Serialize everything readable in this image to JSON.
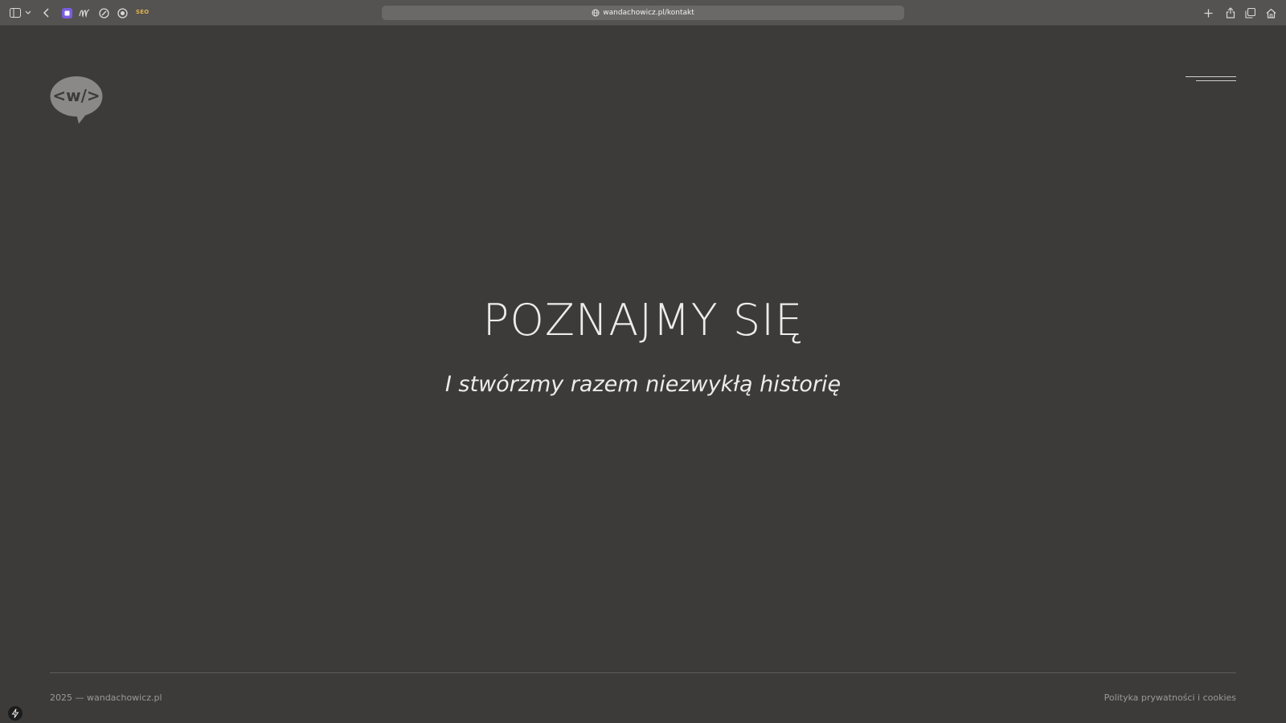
{
  "browser": {
    "url": "wandachowicz.pl/kontakt",
    "extensions_seo_label": "SEO",
    "icons": [
      "sidebar-icon",
      "chevron-down-icon",
      "back-icon",
      "extension-purple-icon",
      "m-script-icon",
      "compass-icon",
      "target-icon",
      "plus-icon",
      "share-icon",
      "tabs-icon",
      "home-icon"
    ]
  },
  "header": {
    "logo_text": "<w/>",
    "menu_icon": "hamburger-icon"
  },
  "hero": {
    "title": "POZNAJMY SIĘ",
    "subtitle": "I stwórzmy razem niezwykłą historię"
  },
  "footer": {
    "copyright": "2025 — wandachowicz.pl",
    "privacy_link": "Polityka prywatności i cookies"
  },
  "colors": {
    "background": "#3c3b3a",
    "toolbar": "#545352",
    "text": "#ececec",
    "muted": "#9a9998",
    "logo_bubble": "#8a8988"
  }
}
